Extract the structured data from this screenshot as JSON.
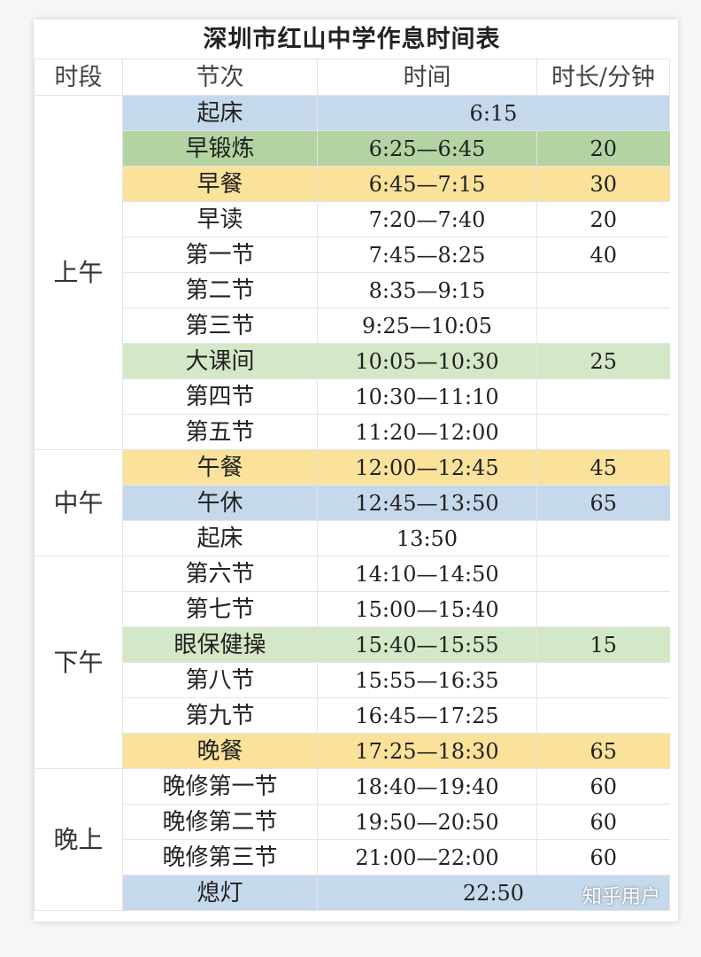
{
  "title": "深圳市红山中学作息时间表",
  "headers": {
    "period": "时段",
    "session": "节次",
    "time": "时间",
    "duration": "时长/分钟"
  },
  "colors": {
    "blue": "#c6d9ec",
    "green": "#b3d3a2",
    "yellow": "#fbe29a",
    "light_green": "#d3e8c6",
    "white": "#ffffff"
  },
  "periods": [
    {
      "label": "上午",
      "start": 0,
      "span": 10
    },
    {
      "label": "中午",
      "start": 10,
      "span": 3
    },
    {
      "label": "下午",
      "start": 13,
      "span": 6
    },
    {
      "label": "晚上",
      "start": 19,
      "span": 4
    }
  ],
  "rows": [
    {
      "name": "起床",
      "time": "6:15",
      "duration": "",
      "color": "blue",
      "merged": true
    },
    {
      "name": "早锻炼",
      "time": "6:25—6:45",
      "duration": "20",
      "color": "green"
    },
    {
      "name": "早餐",
      "time": "6:45—7:15",
      "duration": "30",
      "color": "yellow"
    },
    {
      "name": "早读",
      "time": "7:20—7:40",
      "duration": "20",
      "color": "white"
    },
    {
      "name": "第一节",
      "time": "7:45—8:25",
      "duration": "40",
      "color": "white"
    },
    {
      "name": "第二节",
      "time": "8:35—9:15",
      "duration": "",
      "color": "white"
    },
    {
      "name": "第三节",
      "time": "9:25—10:05",
      "duration": "",
      "color": "white"
    },
    {
      "name": "大课间",
      "time": "10:05—10:30",
      "duration": "25",
      "color": "light_green"
    },
    {
      "name": "第四节",
      "time": "10:30—11:10",
      "duration": "",
      "color": "white"
    },
    {
      "name": "第五节",
      "time": "11:20—12:00",
      "duration": "",
      "color": "white"
    },
    {
      "name": "午餐",
      "time": "12:00—12:45",
      "duration": "45",
      "color": "yellow"
    },
    {
      "name": "午休",
      "time": "12:45—13:50",
      "duration": "65",
      "color": "blue"
    },
    {
      "name": "起床",
      "time": "13:50",
      "duration": "",
      "color": "white"
    },
    {
      "name": "第六节",
      "time": "14:10—14:50",
      "duration": "",
      "color": "white"
    },
    {
      "name": "第七节",
      "time": "15:00—15:40",
      "duration": "",
      "color": "white"
    },
    {
      "name": "眼保健操",
      "time": "15:40—15:55",
      "duration": "15",
      "color": "light_green"
    },
    {
      "name": "第八节",
      "time": "15:55—16:35",
      "duration": "",
      "color": "white"
    },
    {
      "name": "第九节",
      "time": "16:45—17:25",
      "duration": "",
      "color": "white"
    },
    {
      "name": "晚餐",
      "time": "17:25—18:30",
      "duration": "65",
      "color": "yellow"
    },
    {
      "name": "晚修第一节",
      "time": "18:40—19:40",
      "duration": "60",
      "color": "white"
    },
    {
      "name": "晚修第二节",
      "time": "19:50—20:50",
      "duration": "60",
      "color": "white"
    },
    {
      "name": "晚修第三节",
      "time": "21:00—22:00",
      "duration": "60",
      "color": "white"
    },
    {
      "name": "熄灯",
      "time": "22:50",
      "duration": "",
      "color": "blue",
      "merged": true
    }
  ],
  "watermark": "知乎用户"
}
